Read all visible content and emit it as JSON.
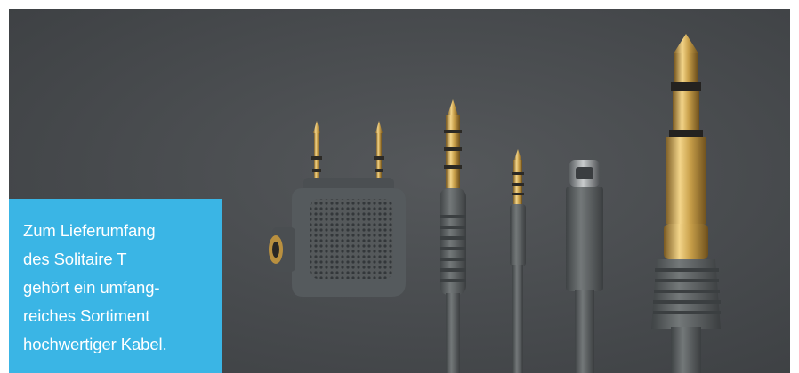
{
  "caption": {
    "lines": [
      "Zum Lieferumfang",
      "des Solitaire T",
      "gehört ein umfang-",
      "reiches Sortiment",
      "hochwertiger Kabel."
    ]
  },
  "colors": {
    "caption_background": "#3ab5e5",
    "caption_text": "#ffffff",
    "backdrop": "#4a4d50",
    "cable_gray": "#5c6163",
    "plug_gold": "#c9a04a"
  }
}
